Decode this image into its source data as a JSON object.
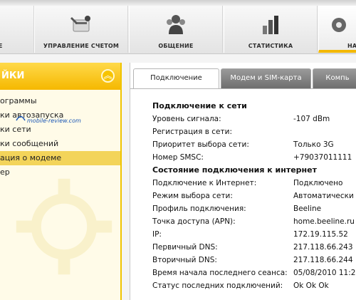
{
  "toolbar": {
    "buttons": [
      {
        "label": "ИЕ",
        "icon": "tools-icon"
      },
      {
        "label": "УПРАВЛЕНИЕ СЧЕТОМ",
        "icon": "card-wrench-icon"
      },
      {
        "label": "ОБЩЕНИЕ",
        "icon": "people-icon"
      },
      {
        "label": "СТАТИСТИКА",
        "icon": "statistics-icon"
      },
      {
        "label": "НА",
        "icon": "settings-icon"
      }
    ]
  },
  "sidebar": {
    "title": "ЙКИ",
    "items": [
      "ограммы",
      "ки автозапуска",
      "ки сети",
      "ки сообщений",
      "ация о модеме",
      "ер"
    ],
    "selected_index": 4,
    "watermark": "mobile-review.com"
  },
  "tabs": [
    {
      "label": "Подключение",
      "active": true
    },
    {
      "label": "Модем и SIM-карта",
      "active": false
    },
    {
      "label": "Компь",
      "active": false
    }
  ],
  "network": {
    "title": "Подключение к сети",
    "rows": [
      {
        "k": "Уровень сигнала:",
        "v": "-107 dBm"
      },
      {
        "k": "Регистрация в сети:",
        "v": ""
      },
      {
        "k": "Приоритет выбора сети:",
        "v": "Только 3G"
      },
      {
        "k": "Номер SMSC:",
        "v": "+79037011111"
      }
    ]
  },
  "internet": {
    "title": "Состояние подключения к интернет",
    "rows": [
      {
        "k": "Подключение к Интернет:",
        "v": "Подключено"
      },
      {
        "k": "Режим выбора сети:",
        "v": "Автоматически"
      },
      {
        "k": "Профиль подключения:",
        "v": "Beeline"
      },
      {
        "k": "Точка доступа (APN):",
        "v": "home.beeline.ru"
      },
      {
        "k": " IP:",
        "v": "172.19.115.52"
      },
      {
        "k": "Первичный DNS:",
        "v": "217.118.66.243"
      },
      {
        "k": "Вторичный DNS:",
        "v": "217.118.66.244"
      },
      {
        "k": "Время начала последнего сеанса:",
        "v": "05/08/2010 11:21"
      },
      {
        "k": "Статус последних подключений:",
        "v": "Ok Ok Ok"
      }
    ]
  },
  "colors": {
    "accent": "#f5b800",
    "sidebar_bg": "#fffbe8",
    "selected": "#f3d45a"
  }
}
